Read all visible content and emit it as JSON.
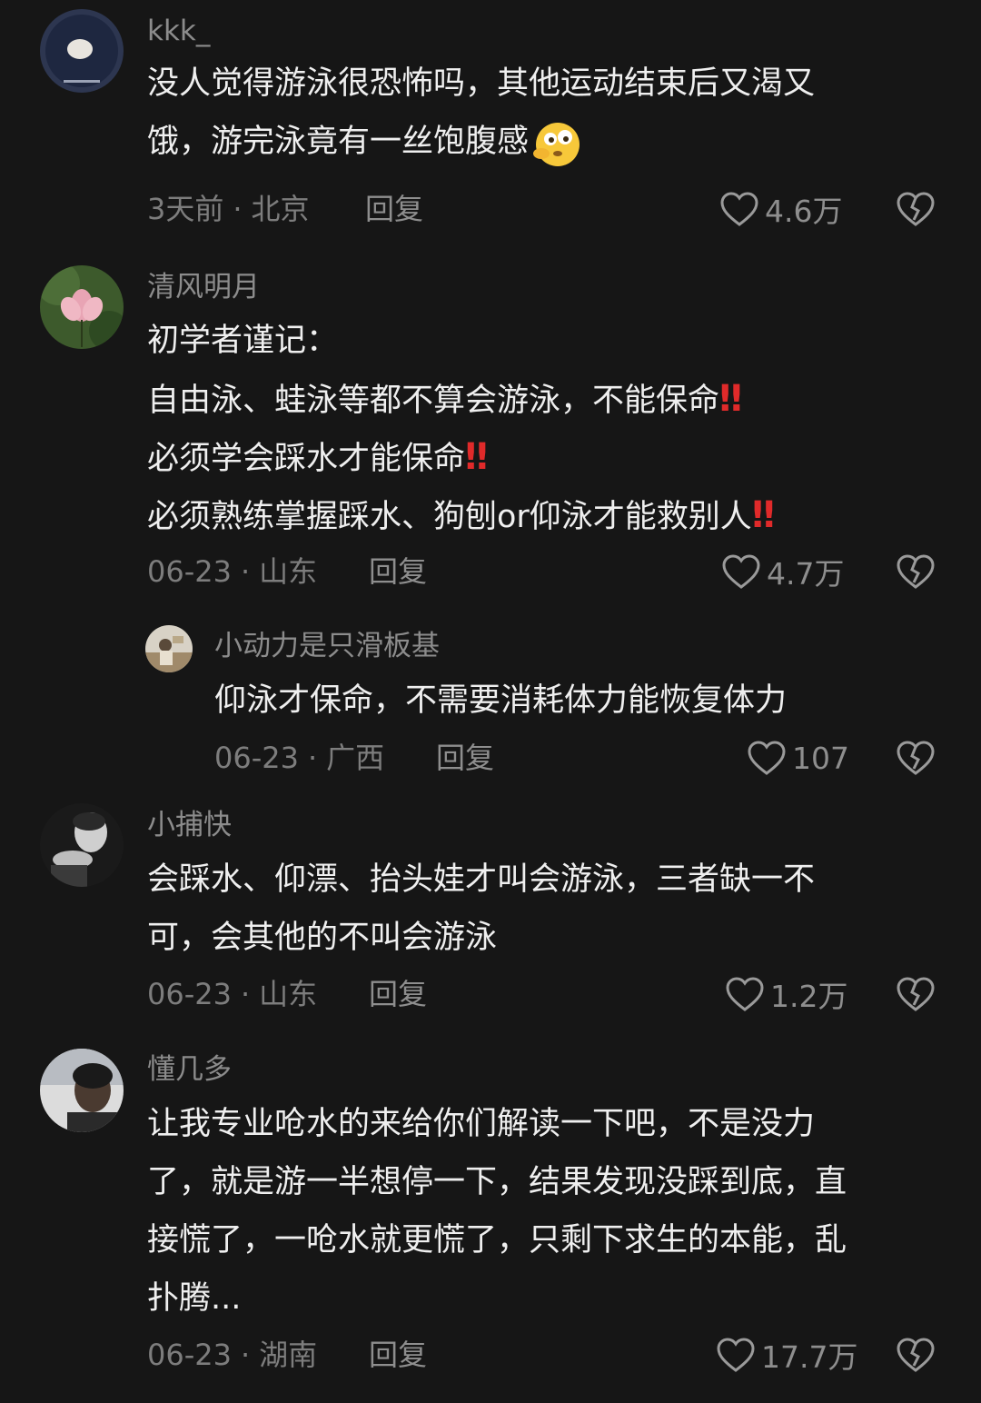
{
  "colors": {
    "background": "#161616",
    "text": "#efefef",
    "muted": "#8c8c8c",
    "exclamation": "#e02a2a"
  },
  "reply_label": "回复",
  "comments": [
    {
      "username": "kkk_",
      "lines": [
        "没人觉得游泳很恐怖吗，其他运动结束后又渴又",
        "饿，游完泳竟有一丝饱腹感"
      ],
      "emoji": "emoji-thinking-face",
      "time": "3天前",
      "location": "北京",
      "likes": "4.6万"
    },
    {
      "username": "清风明月",
      "lines": [
        "初学者谨记：",
        "自由泳、蛙泳等都不算会游泳，不能保命",
        "必须学会踩水才能保命",
        "必须熟练掌握踩水、狗刨or仰泳才能救别人"
      ],
      "exclaim": "‼",
      "time": "06-23",
      "location": "山东",
      "likes": "4.7万"
    },
    {
      "username": "小动力是只滑板基",
      "lines": [
        "仰泳才保命，不需要消耗体力能恢复体力"
      ],
      "time": "06-23",
      "location": "广西",
      "likes": "107"
    },
    {
      "username": "小捕快",
      "lines": [
        "会踩水、仰漂、抬头娃才叫会游泳，三者缺一不",
        "可，会其他的不叫会游泳"
      ],
      "time": "06-23",
      "location": "山东",
      "likes": "1.2万"
    },
    {
      "username": "懂几多",
      "lines": [
        "让我专业呛水的来给你们解读一下吧，不是没力",
        "了，就是游一半想停一下，结果发现没踩到底，直",
        "接慌了，一呛水就更慌了，只剩下求生的本能，乱",
        "扑腾..."
      ],
      "time": "06-23",
      "location": "湖南",
      "likes": "17.7万"
    }
  ]
}
